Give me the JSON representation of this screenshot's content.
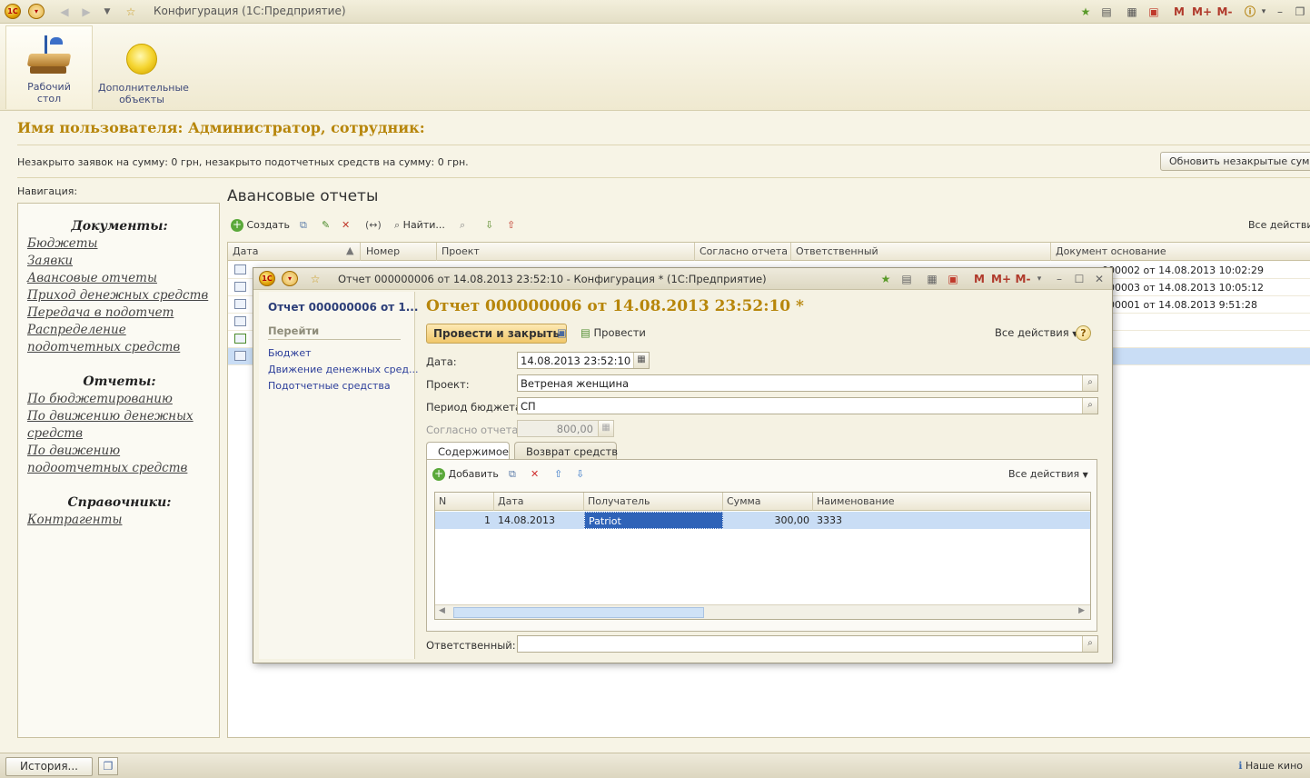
{
  "window": {
    "title": "Конфигурация  (1С:Предприятие)",
    "right_tools": [
      "M",
      "M+",
      "M-"
    ]
  },
  "sections": [
    {
      "label_line1": "Рабочий",
      "label_line2": "стол",
      "icon": "desk-lamp-icon"
    },
    {
      "label_line1": "Дополнительные",
      "label_line2": "объекты",
      "icon": "yellow-ball-icon"
    }
  ],
  "header": {
    "user_line": "Имя пользователя: Администратор, сотрудник:",
    "info": "Незакрыто заявок на сумму: 0 грн, незакрыто подотчетных средств на сумму: 0 грн.",
    "refresh_button": "Обновить незакрытые суммы"
  },
  "navigation": {
    "label": "Навигация:",
    "documents_title": "Документы:",
    "documents": [
      "Бюджеты",
      "Заявки",
      "Авансовые отчеты",
      "Приход денежных средств",
      "Передача в подотчет",
      "Распределение",
      "подотчетных средств"
    ],
    "reports_title": "Отчеты:",
    "reports": [
      "По бюджетированию",
      "По движению денежных",
      "средств",
      "По движению",
      "подоотчетных средств"
    ],
    "catalogs_title": "Справочники:",
    "catalogs": [
      "Контрагенты"
    ]
  },
  "list": {
    "title": "Авансовые отчеты",
    "create_button": "Создать",
    "find_button": "Найти...",
    "all_actions": "Все действия",
    "columns": [
      "Дата",
      "Номер",
      "Проект",
      "Согласно отчета",
      "Ответственный",
      "Документ основание"
    ],
    "rows": [
      {
        "basis": "000002 от 14.08.2013 10:02:29"
      },
      {
        "basis": "000003 от 14.08.2013 10:05:12"
      },
      {
        "basis": "000001 от 14.08.2013 9:51:28"
      },
      {
        "basis": ""
      },
      {
        "basis": ""
      },
      {
        "basis": ""
      }
    ]
  },
  "modal": {
    "title": "Отчет 000000006 от 14.08.2013 23:52:10 - Конфигурация *  (1С:Предприятие)",
    "side_title": "Отчет 000000006 от 1...",
    "side_go": "Перейти",
    "side_links": [
      "Бюджет",
      "Движение денежных сред...",
      "Подотчетные средства"
    ],
    "heading": "Отчет 000000006 от 14.08.2013 23:52:10 *",
    "post_close_button": "Провести и закрыть",
    "post_button": "Провести",
    "all_actions": "Все действия",
    "fields": {
      "date_label": "Дата:",
      "date_value": "14.08.2013 23:52:10",
      "project_label": "Проект:",
      "project_value": "Ветреная женщина",
      "period_label": "Период бюджета:",
      "period_value": "СП",
      "report_label": "Согласно отчета:",
      "report_value": "800,00",
      "responsible_label": "Ответственный:",
      "responsible_value": ""
    },
    "tabs": [
      "Содержимое",
      "Возврат средств"
    ],
    "add_button": "Добавить",
    "table_all_actions": "Все действия",
    "table": {
      "columns": [
        "N",
        "Дата",
        "Получатель",
        "Сумма",
        "Наименование"
      ],
      "rows": [
        {
          "n": "1",
          "date": "14.08.2013",
          "recipient": "Patriot",
          "sum": "300,00",
          "name": "3333"
        }
      ]
    }
  },
  "statusbar": {
    "history_button": "История...",
    "right_text": "Наше кино"
  }
}
